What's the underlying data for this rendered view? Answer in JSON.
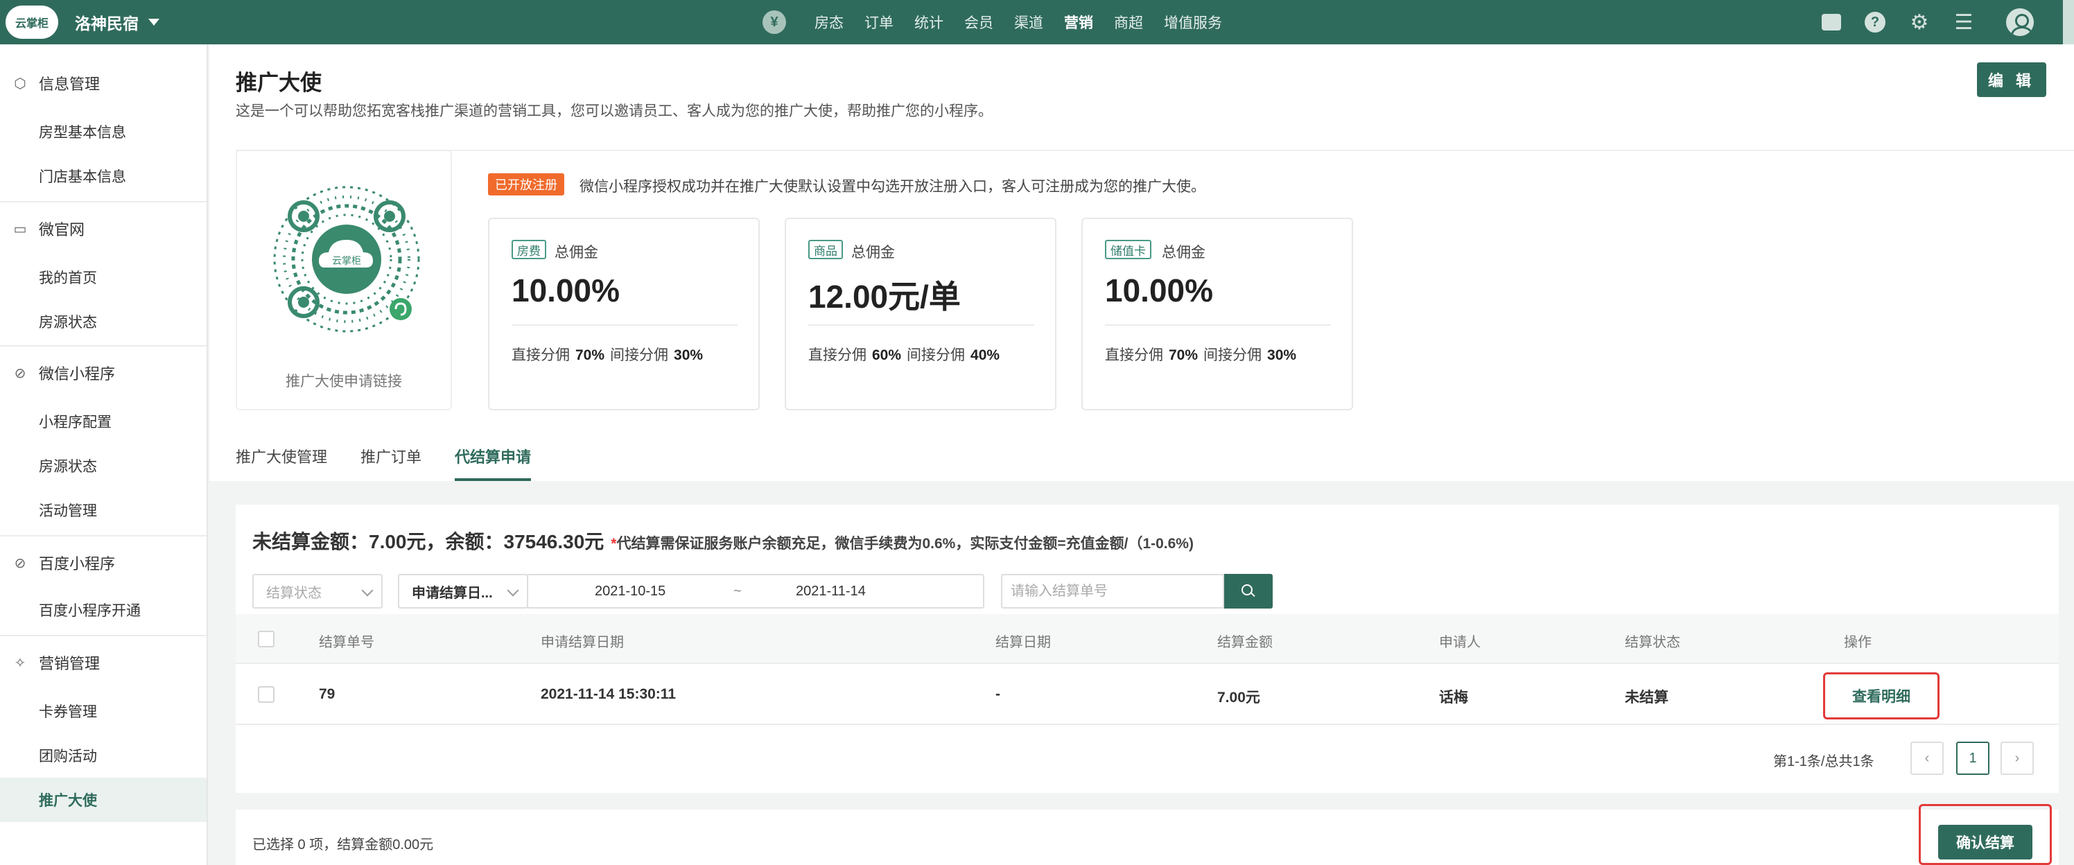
{
  "brand": {
    "logo_text": "云掌柜",
    "hotel_name": "洛神民宿"
  },
  "topnav": {
    "coin_glyph": "¥",
    "items": [
      "房态",
      "订单",
      "统计",
      "会员",
      "渠道",
      "营销",
      "商超",
      "增值服务"
    ],
    "active": "营销",
    "icons": [
      "message-icon",
      "help-icon",
      "gear-icon",
      "menu-icon",
      "user-avatar-icon"
    ]
  },
  "sidebar": {
    "groups": [
      {
        "label": "信息管理",
        "icon": "cube-icon",
        "items": [
          "房型基本信息",
          "门店基本信息"
        ]
      },
      {
        "label": "微官网",
        "icon": "monitor-icon",
        "items": [
          "我的首页",
          "房源状态"
        ]
      },
      {
        "label": "微信小程序",
        "icon": "compass-icon",
        "items": [
          "小程序配置",
          "房源状态",
          "活动管理"
        ]
      },
      {
        "label": "百度小程序",
        "icon": "compass-icon",
        "items": [
          "百度小程序开通"
        ]
      },
      {
        "label": "营销管理",
        "icon": "megaphone-icon",
        "items": [
          "卡券管理",
          "团购活动",
          "推广大使"
        ]
      }
    ],
    "active_item": "推广大使"
  },
  "page": {
    "title": "推广大使",
    "description": "这是一个可以帮助您拓宽客栈推广渠道的营销工具，您可以邀请员工、客人成为您的推广大使，帮助推广您的小程序。",
    "edit_label": "编 辑",
    "qr_label": "推广大使申请链接",
    "qr_center_text": "云掌柜",
    "open_badge": "已开放注册",
    "open_desc": "微信小程序授权成功并在推广大使默认设置中勾选开放注册入口，客人可注册成为您的推广大使。"
  },
  "stats": [
    {
      "tag": "房费",
      "name": "总佣金",
      "value": "10.00%",
      "direct_label": "直接分佣",
      "direct": "70%",
      "indirect_label": "间接分佣",
      "indirect": "30%"
    },
    {
      "tag": "商品",
      "name": "总佣金",
      "value": "12.00元/单",
      "direct_label": "直接分佣",
      "direct": "60%",
      "indirect_label": "间接分佣",
      "indirect": "40%"
    },
    {
      "tag": "储值卡",
      "name": "总佣金",
      "value": "10.00%",
      "direct_label": "直接分佣",
      "direct": "70%",
      "indirect_label": "间接分佣",
      "indirect": "30%"
    }
  ],
  "tabs": [
    "推广大使管理",
    "推广订单",
    "代结算申请"
  ],
  "active_tab": "代结算申请",
  "settlement": {
    "summary": "未结算金额：7.00元，余额：37546.30元",
    "note_star": "*",
    "note": "代结算需保证服务账户余额充足，微信手续费为0.6%，实际支付金额=充值金额/（1-0.6%)",
    "filters": {
      "status_placeholder": "结算状态",
      "date_type": "申请结算日...",
      "date_from": "2021-10-15",
      "date_sep": "~",
      "date_to": "2021-11-14",
      "search_placeholder": "请输入结算单号"
    },
    "columns": [
      "结算单号",
      "申请结算日期",
      "结算日期",
      "结算金额",
      "申请人",
      "结算状态",
      "操作"
    ],
    "rows": [
      {
        "id": "79",
        "apply_date": "2021-11-14 15:30:11",
        "settle_date": "-",
        "amount": "7.00元",
        "applicant": "话梅",
        "status": "未结算",
        "action": "查看明细"
      }
    ],
    "pagination": {
      "info": "第1-1条/总共1条",
      "current": "1"
    },
    "selected_info": "已选择 0 项，结算金额0.00元",
    "confirm_label": "确认结算"
  }
}
